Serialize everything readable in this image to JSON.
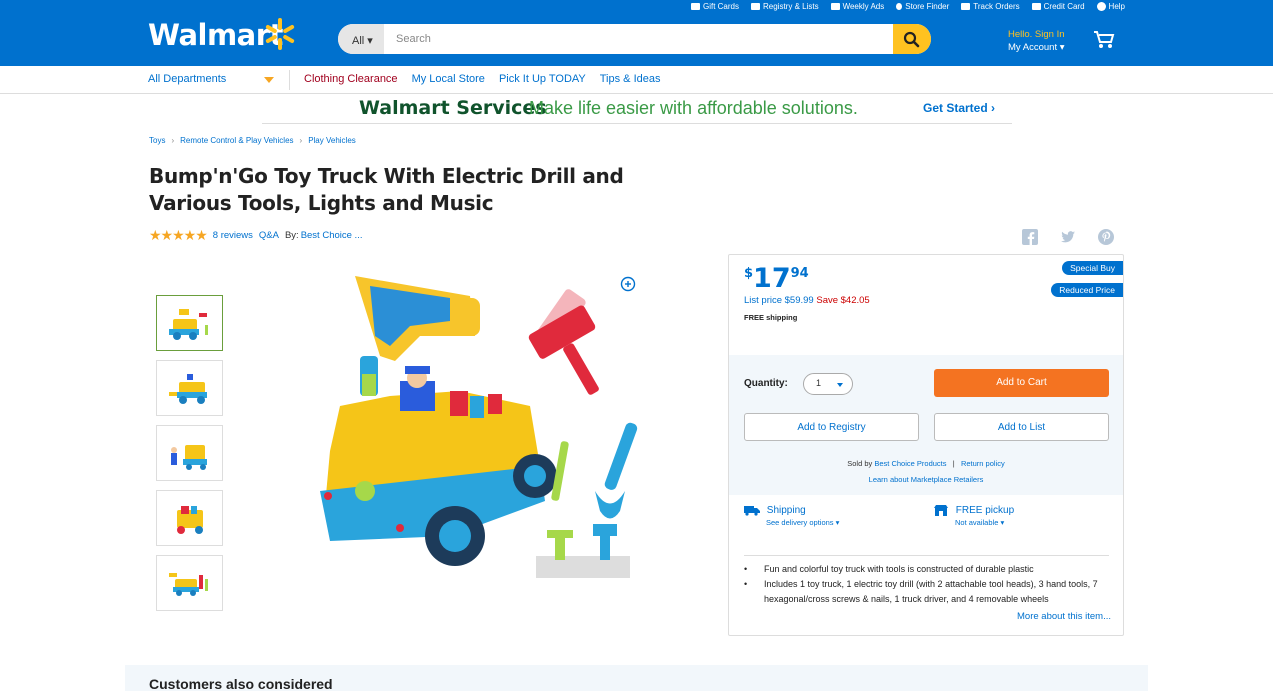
{
  "header": {
    "logo_text": "Walmart",
    "search": {
      "category": "All",
      "placeholder": "Search"
    },
    "top_links": [
      "Gift Cards",
      "Registry & Lists",
      "Weekly Ads",
      "Store Finder",
      "Track Orders",
      "Credit Card",
      "Help"
    ],
    "account_greeting": "Hello. Sign In",
    "account_label": "My Account",
    "brand_color": "#0071ce",
    "accent_color": "#ffc220"
  },
  "nav": {
    "departments": "All Departments",
    "links": [
      "Clothing Clearance",
      "My Local Store",
      "Pick It Up TODAY",
      "Tips & Ideas"
    ]
  },
  "banner": {
    "brand": "Walmart Services",
    "tagline": "Make life easier with affordable solutions.",
    "cta": "Get Started ›"
  },
  "breadcrumb": [
    "Toys",
    "Remote Control & Play Vehicles",
    "Play Vehicles"
  ],
  "product": {
    "title": "Bump'n'Go Toy Truck With Electric Drill and Various Tools, Lights and Music",
    "rating": 4.5,
    "stars_text": "★★★★★",
    "reviews": "8 reviews",
    "qa": "Q&A",
    "by_label": "By:",
    "brand": "Best Choice ..."
  },
  "buybox": {
    "currency": "$",
    "price_main": "17",
    "price_cents": "94",
    "list_price": "List price $59.99",
    "save": "Save $42.05",
    "shipping_note": "FREE shipping",
    "badges": [
      "Special Buy",
      "Reduced Price"
    ],
    "quantity_label": "Quantity:",
    "quantity_value": "1",
    "add_to_cart": "Add to Cart",
    "add_to_registry": "Add to Registry",
    "add_to_list": "Add to List",
    "sold_by_label": "Sold by",
    "seller": "Best Choice Products",
    "return_policy": "Return policy",
    "marketplace": "Learn about Marketplace Retailers",
    "shipping": {
      "label": "Shipping",
      "sub": "See delivery options"
    },
    "pickup": {
      "label": "FREE pickup",
      "sub": "Not available"
    },
    "bullets": [
      "Fun and colorful toy truck with tools is constructed of durable plastic",
      "Includes 1 toy truck, 1 electric toy drill (with 2 attachable tool heads), 3 hand tools, 7 hexagonal/cross screws & nails, 1 truck driver, and 4 removable wheels"
    ],
    "more_link": "More about this item..."
  },
  "considered_title": "Customers also considered"
}
